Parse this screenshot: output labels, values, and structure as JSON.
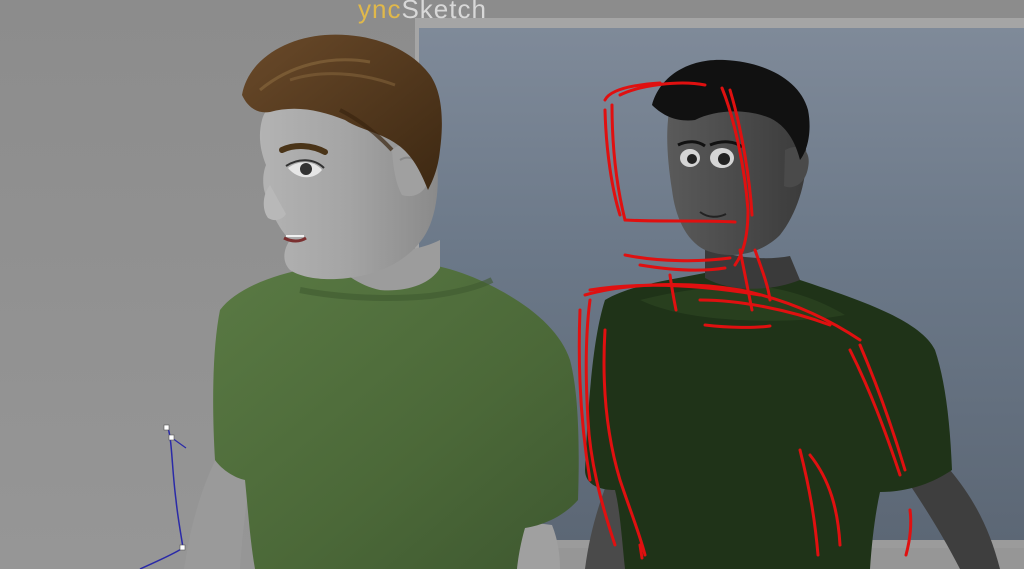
{
  "app": {
    "reference_plate_label": {
      "accent_part": "ync",
      "rest_part": "Sketch"
    }
  },
  "colors": {
    "viewport_bg": "#8f8f8f",
    "shirt_green": "#4e6b3a",
    "shirt_green_dark": "#1f3318",
    "sketch_stroke": "#e01010",
    "motion_curve": "#2a2aa8"
  },
  "icons": {
    "motion_path_key": "square-keyframe-icon"
  }
}
